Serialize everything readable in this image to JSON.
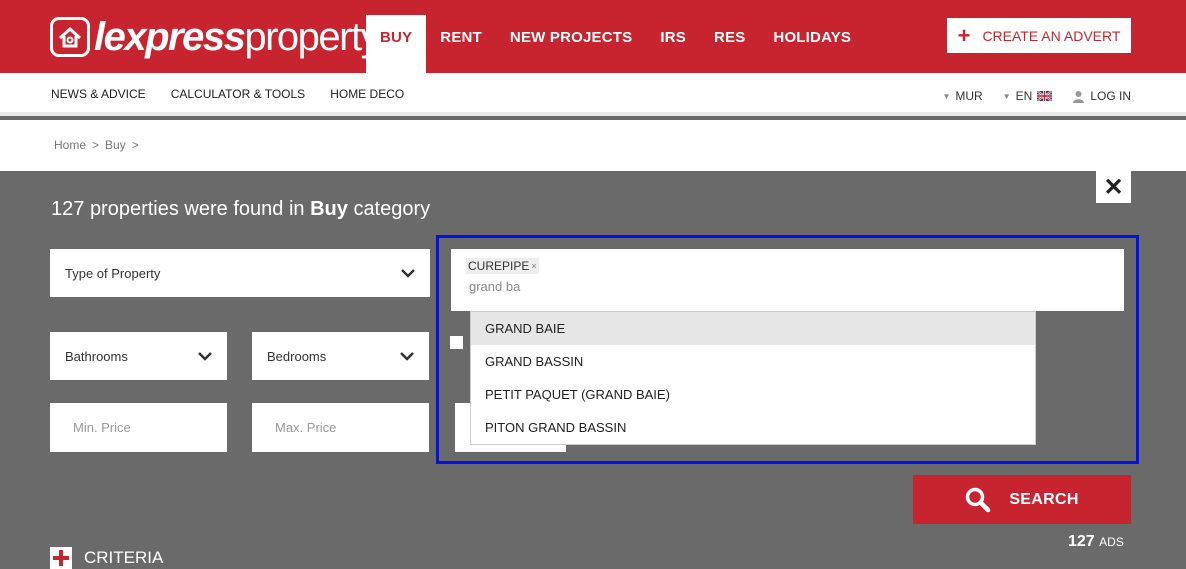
{
  "header": {
    "logo": {
      "bold": "lexpress",
      "light": "property"
    },
    "nav": [
      {
        "label": "BUY",
        "active": true
      },
      {
        "label": "RENT"
      },
      {
        "label": "NEW PROJECTS"
      },
      {
        "label": "IRS"
      },
      {
        "label": "RES"
      },
      {
        "label": "HOLIDAYS"
      }
    ],
    "create_advert": "CREATE AN ADVERT",
    "brand_color": "#c8242f"
  },
  "subnav": {
    "links": [
      "NEWS & ADVICE",
      "CALCULATOR & TOOLS",
      "HOME DECO"
    ],
    "currency": "MUR",
    "language": "EN",
    "login": "LOG IN"
  },
  "breadcrumb": [
    "Home",
    "Buy"
  ],
  "search": {
    "result_count": "127",
    "result_prefix": "properties were found in",
    "category": "Buy",
    "result_suffix": "category",
    "type_of_property": "Type of Property",
    "bathrooms": "Bathrooms",
    "bedrooms": "Bedrooms",
    "min_price_placeholder": "Min. Price",
    "max_price_placeholder": "Max. Price",
    "location_tag": "CUREPIPE",
    "location_query": "grand ba",
    "suggestions": [
      "GRAND BAIE",
      "GRAND BASSIN",
      "PETIT PAQUET (GRAND BAIE)",
      "PITON GRAND BASSIN"
    ],
    "search_button": "SEARCH",
    "ads_count": "127",
    "ads_label": "ADS",
    "criteria": "CRITERIA"
  }
}
